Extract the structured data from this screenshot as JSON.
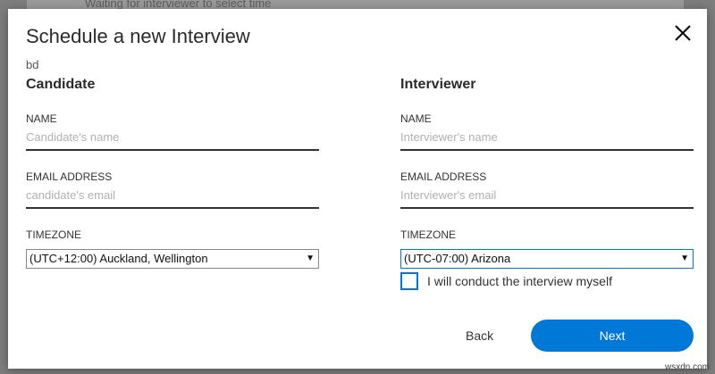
{
  "backdrop": {
    "text": "Waiting for interviewer to select time"
  },
  "dialog": {
    "title": "Schedule a new Interview",
    "subtitle": "bd",
    "close_icon": "close-icon"
  },
  "candidate": {
    "heading": "Candidate",
    "name_label": "NAME",
    "name_placeholder": "Candidate's name",
    "email_label": "EMAIL ADDRESS",
    "email_placeholder": "candidate's email",
    "timezone_label": "TIMEZONE",
    "timezone_value": "(UTC+12:00) Auckland, Wellington"
  },
  "interviewer": {
    "heading": "Interviewer",
    "name_label": "NAME",
    "name_placeholder": "Interviewer's name",
    "email_label": "EMAIL ADDRESS",
    "email_placeholder": "Interviewer's email",
    "timezone_label": "TIMEZONE",
    "timezone_value": "(UTC-07:00) Arizona"
  },
  "self_conduct": {
    "label": "I will conduct the interview myself",
    "checked": false
  },
  "actions": {
    "back_label": "Back",
    "next_label": "Next"
  },
  "colors": {
    "accent": "#0078d7"
  },
  "watermark": "wsxdn.com"
}
